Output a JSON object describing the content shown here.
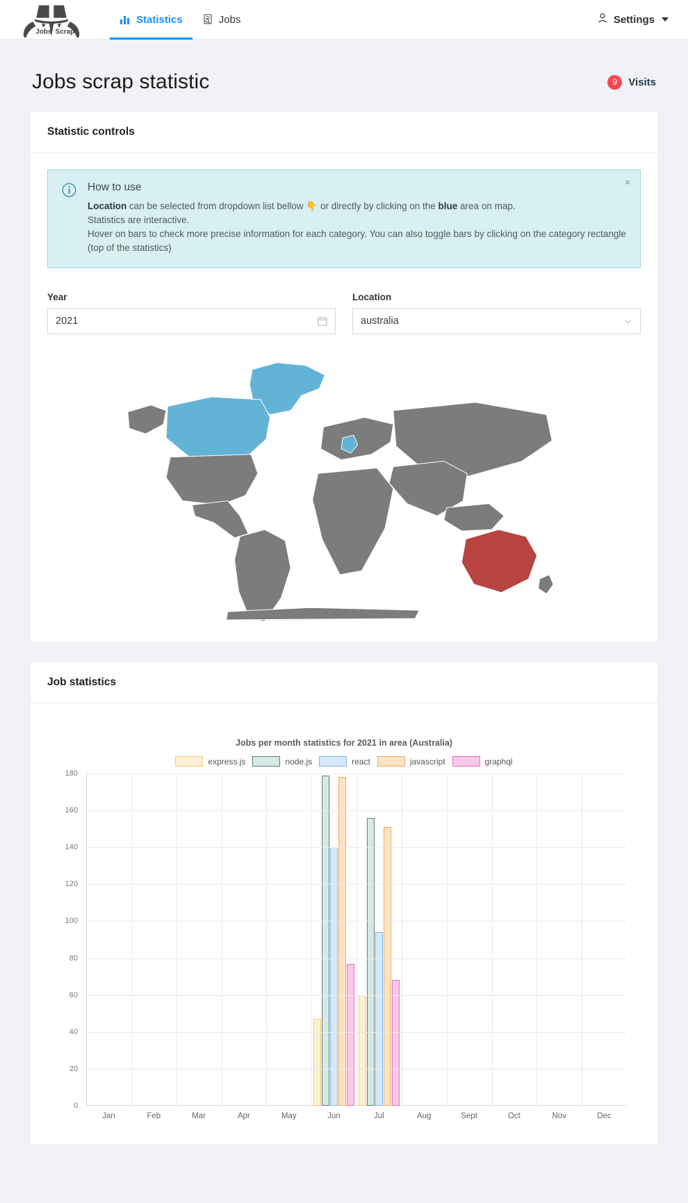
{
  "nav": {
    "logo_text_left": "Jobs",
    "logo_text_right": "Scrap",
    "items": [
      {
        "label": "Statistics",
        "icon": "bar-chart-icon",
        "active": true
      },
      {
        "label": "Jobs",
        "icon": "file-search-icon",
        "active": false
      }
    ],
    "settings_label": "Settings",
    "settings_icon": "user-icon",
    "caret_icon": "chevron-down-icon"
  },
  "page": {
    "title": "Jobs scrap statistic",
    "visits_count": "9",
    "visits_label": "Visits"
  },
  "controls_card": {
    "title": "Statistic controls"
  },
  "alert": {
    "icon": "info-circle-icon",
    "title": "How to use",
    "line1_bold_1": "Location",
    "line1_mid": " can be selected from dropdown list bellow ",
    "line1_emoji": "👇",
    "line1_after_emoji": " or directly by clicking on the ",
    "line1_bold_2": "blue",
    "line1_end": " area on map.",
    "line2": "Statistics are interactive.",
    "line3": "Hover on bars to check more precise information for each category. You can also toggle bars by clicking on the category rectangle (top of the statistics)",
    "close_label": "×"
  },
  "form": {
    "year": {
      "label": "Year",
      "value": "2021",
      "placeholder": "Select year",
      "suffix_icon": "calendar-icon"
    },
    "location": {
      "label": "Location",
      "value": "australia",
      "placeholder": "Select location",
      "suffix_icon": "chevron-down-icon"
    }
  },
  "map": {
    "selected_country": "australia",
    "selected_color": "#b84440",
    "selectable_color": "#63b3d6",
    "default_color": "#7c7c7c",
    "stroke_color": "#ffffff"
  },
  "stats_card": {
    "title": "Job statistics"
  },
  "chart_data": {
    "type": "bar",
    "title": "Jobs per month statistics for 2021 in area (Australia)",
    "xlabel": "",
    "ylabel": "",
    "ylim": [
      0,
      180
    ],
    "ytick_step": 20,
    "yticks": [
      0,
      20,
      40,
      60,
      80,
      100,
      120,
      140,
      160,
      180
    ],
    "grid": true,
    "legend_position": "top",
    "categories": [
      "Jan",
      "Feb",
      "Mar",
      "Apr",
      "May",
      "Jun",
      "Jul",
      "Aug",
      "Sept",
      "Oct",
      "Nov",
      "Dec"
    ],
    "series": [
      {
        "name": "express.js",
        "fill": "#fdefd4",
        "stroke": "#f6c濃",
        "border": "#f5c97a",
        "values": [
          0,
          0,
          0,
          0,
          0,
          47,
          60,
          0,
          0,
          0,
          0,
          0
        ]
      },
      {
        "name": "node.js",
        "fill": "#d7e9e6",
        "border": "#5f7e7c",
        "values": [
          0,
          0,
          0,
          0,
          0,
          179,
          156,
          0,
          0,
          0,
          0,
          0
        ]
      },
      {
        "name": "react",
        "fill": "#d7e8fb",
        "border": "#7cb8ef",
        "values": [
          0,
          0,
          0,
          0,
          0,
          140,
          94,
          0,
          0,
          0,
          0,
          0
        ]
      },
      {
        "name": "javascript",
        "fill": "#fde3c5",
        "border": "#f5a95a",
        "values": [
          0,
          0,
          0,
          0,
          0,
          178,
          151,
          0,
          0,
          0,
          0,
          0
        ]
      },
      {
        "name": "graphql",
        "fill": "#f7c9e8",
        "border": "#e86ec4",
        "values": [
          0,
          0,
          0,
          0,
          0,
          77,
          68,
          0,
          0,
          0,
          0,
          0
        ]
      }
    ]
  }
}
